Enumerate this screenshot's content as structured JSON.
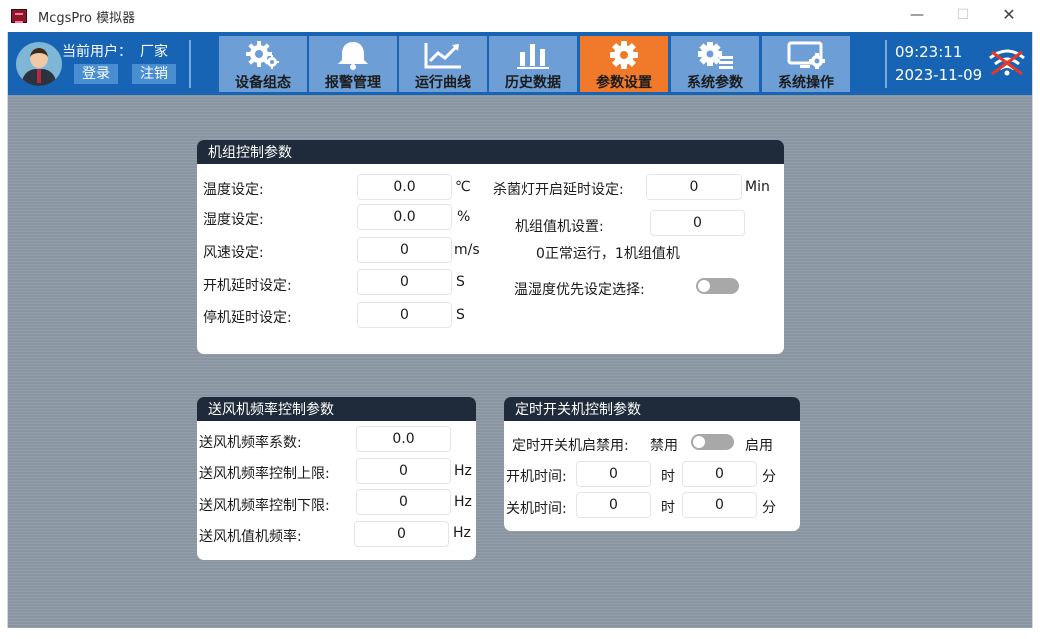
{
  "window": {
    "title": "McgsPro 模拟器",
    "min": "—",
    "max": "☐",
    "close": "✕"
  },
  "header": {
    "user_label": "当前用户：",
    "user_name": "厂家",
    "login": "登录",
    "logout": "注销",
    "time": "09:23:11",
    "date": "2023-11-09"
  },
  "nav": {
    "tabs": [
      {
        "label": "设备组态",
        "icon": "gears-icon",
        "active": false
      },
      {
        "label": "报警管理",
        "icon": "bell-icon",
        "active": false
      },
      {
        "label": "运行曲线",
        "icon": "trend-chart-icon",
        "active": false
      },
      {
        "label": "历史数据",
        "icon": "bar-chart-icon",
        "active": false
      },
      {
        "label": "参数设置",
        "icon": "gear-icon",
        "active": true
      },
      {
        "label": "系统参数",
        "icon": "gear-list-icon",
        "active": false
      },
      {
        "label": "系统操作",
        "icon": "monitor-gear-icon",
        "active": false
      }
    ]
  },
  "unit_control": {
    "title": "机组控制参数",
    "temp_label": "温度设定:",
    "temp_value": "0.0",
    "temp_unit": "℃",
    "hum_label": "湿度设定:",
    "hum_value": "0.0",
    "hum_unit": "%",
    "wind_label": "风速设定:",
    "wind_value": "0",
    "wind_unit": "m/s",
    "start_delay_label": "开机延时设定:",
    "start_delay_value": "0",
    "start_delay_unit": "S",
    "stop_delay_label": "停机延时设定:",
    "stop_delay_value": "0",
    "stop_delay_unit": "S",
    "uv_label": "杀菌灯开启延时设定:",
    "uv_value": "0",
    "uv_unit": "Min",
    "duty_label": "机组值机设置:",
    "duty_value": "0",
    "duty_hint": "0正常运行，1机组值机",
    "priority_label": "温湿度优先设定选择:",
    "priority_on": false
  },
  "fan_freq": {
    "title": "送风机频率控制参数",
    "coef_label": "送风机频率系数:",
    "coef_value": "0.0",
    "upper_label": "送风机频率控制上限:",
    "upper_value": "0",
    "upper_unit": "Hz",
    "lower_label": "送风机频率控制下限:",
    "lower_value": "0",
    "lower_unit": "Hz",
    "duty_label": "送风机值机频率:",
    "duty_value": "0",
    "duty_unit": "Hz"
  },
  "timer": {
    "title": "定时开关机控制参数",
    "enable_label": "定时开关机启禁用:",
    "disable_text": "禁用",
    "enable_text": "启用",
    "enabled": false,
    "on_label": "开机时间:",
    "on_hour": "0",
    "on_min": "0",
    "off_label": "关机时间:",
    "off_hour": "0",
    "off_min": "0",
    "hour_unit": "时",
    "min_unit": "分"
  },
  "colors": {
    "header": "#1764b4",
    "tab": "#6d9ed6",
    "tab_active": "#f07a2a",
    "panel_head": "#1f2b3a",
    "canvas": "#8e9aa7"
  }
}
